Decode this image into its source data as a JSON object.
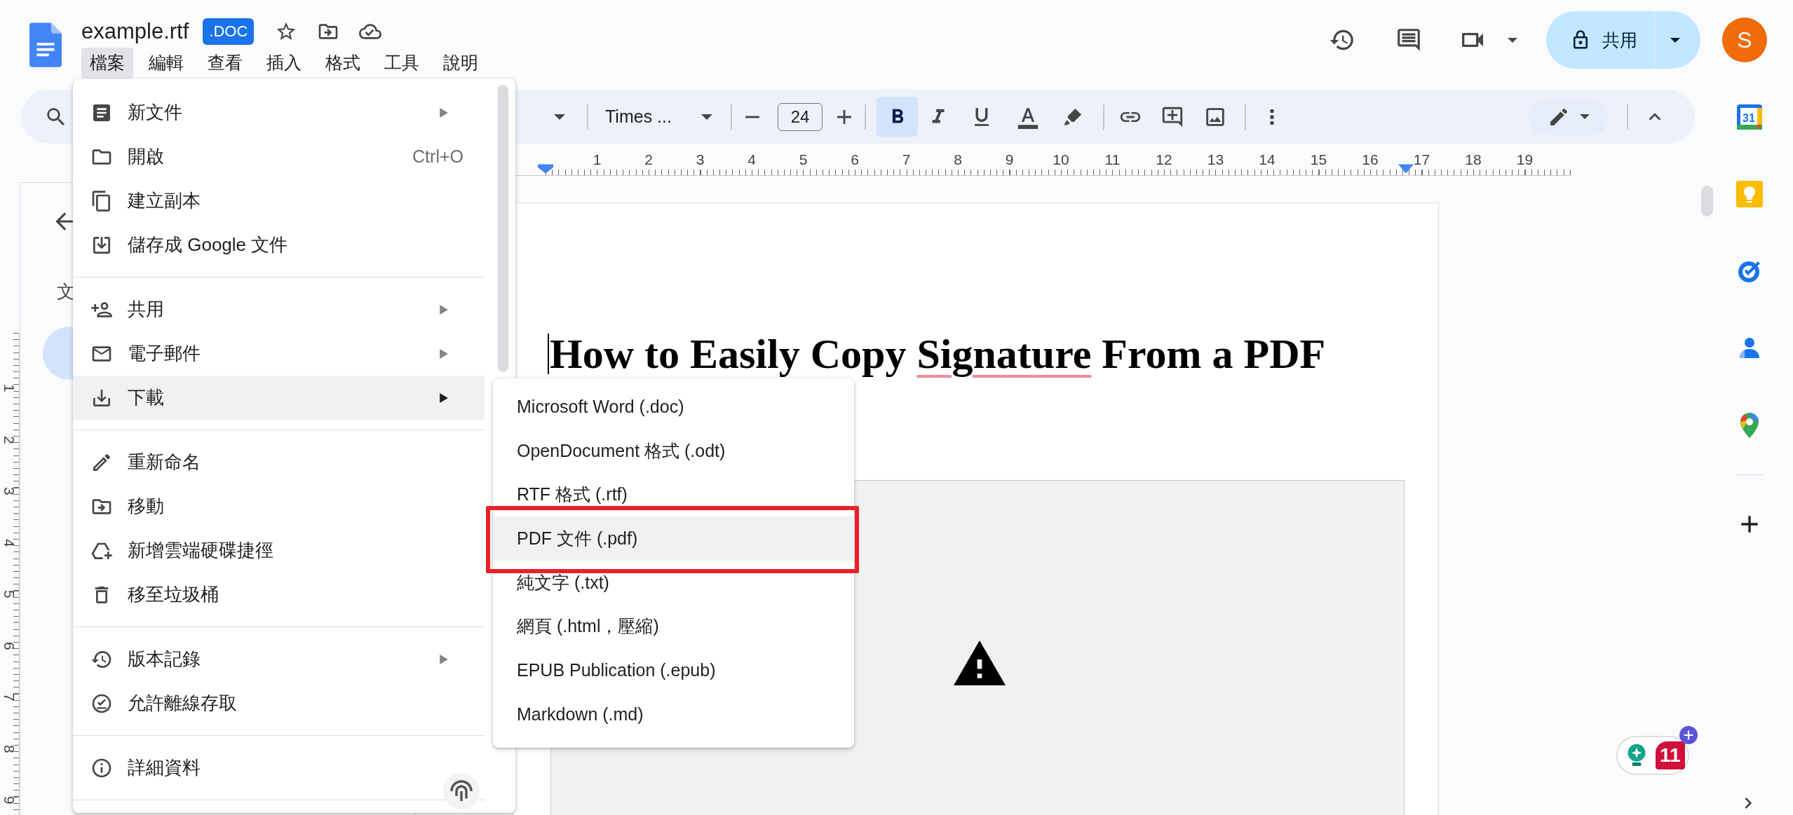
{
  "document": {
    "title": "example.rtf",
    "badge": ".DOC"
  },
  "menu_bar": [
    {
      "label": "檔案",
      "selected": true
    },
    {
      "label": "編輯",
      "selected": false
    },
    {
      "label": "查看",
      "selected": false
    },
    {
      "label": "插入",
      "selected": false
    },
    {
      "label": "格式",
      "selected": false
    },
    {
      "label": "工具",
      "selected": false
    },
    {
      "label": "說明",
      "selected": false
    }
  ],
  "share_button": {
    "label": "共用"
  },
  "avatar": {
    "initial": "S"
  },
  "toolbar": {
    "font": "Times ...",
    "font_size": "24",
    "bold": true,
    "italic": false,
    "underline": false
  },
  "ruler": {
    "marks": [
      "1",
      "2",
      "3",
      "4",
      "5",
      "6",
      "7",
      "8",
      "9",
      "10",
      "11",
      "12",
      "13",
      "14",
      "15",
      "16",
      "17",
      "18",
      "19"
    ]
  },
  "vertical_ruler": {
    "marks": [
      "1",
      "2",
      "3",
      "4",
      "5",
      "6",
      "7",
      "8",
      "9"
    ]
  },
  "outline_panel": {
    "label": "文"
  },
  "page": {
    "heading": [
      {
        "text": "How to Easily Copy ",
        "flagged": false
      },
      {
        "text": "Signature",
        "flagged": true
      },
      {
        "text": " From a PDF",
        "flagged": false
      }
    ]
  },
  "file_menu": {
    "sections": [
      {
        "items": [
          {
            "label": "新文件",
            "submenu": true,
            "selected": false
          },
          {
            "label": "開啟",
            "shortcut": "Ctrl+O",
            "submenu": false,
            "selected": false
          },
          {
            "label": "建立副本",
            "submenu": false,
            "selected": false
          },
          {
            "label": "儲存成 Google 文件",
            "submenu": false,
            "selected": false
          }
        ]
      },
      {
        "items": [
          {
            "label": "共用",
            "submenu": true,
            "selected": false
          },
          {
            "label": "電子郵件",
            "submenu": true,
            "selected": false
          },
          {
            "label": "下載",
            "submenu": true,
            "selected": true
          }
        ]
      },
      {
        "items": [
          {
            "label": "重新命名",
            "submenu": false,
            "selected": false
          },
          {
            "label": "移動",
            "submenu": false,
            "selected": false
          },
          {
            "label": "新增雲端硬碟捷徑",
            "submenu": false,
            "selected": false
          },
          {
            "label": "移至垃圾桶",
            "submenu": false,
            "selected": false
          }
        ]
      },
      {
        "items": [
          {
            "label": "版本記錄",
            "submenu": true,
            "selected": false
          },
          {
            "label": "允許離線存取",
            "submenu": false,
            "selected": false
          }
        ]
      },
      {
        "items": [
          {
            "label": "詳細資料",
            "submenu": false,
            "selected": false
          }
        ]
      }
    ]
  },
  "download_submenu": {
    "items": [
      {
        "label": "Microsoft Word (.doc)",
        "selected": false,
        "callout": false
      },
      {
        "label": "OpenDocument 格式 (.odt)",
        "selected": false,
        "callout": false
      },
      {
        "label": "RTF 格式 (.rtf)",
        "selected": false,
        "callout": false
      },
      {
        "label": "PDF 文件 (.pdf)",
        "selected": true,
        "callout": true
      },
      {
        "label": "純文字 (.txt)",
        "selected": false,
        "callout": false
      },
      {
        "label": "網頁 (.html，壓縮)",
        "selected": false,
        "callout": false
      },
      {
        "label": "EPUB Publication (.epub)",
        "selected": false,
        "callout": false
      },
      {
        "label": "Markdown (.md)",
        "selected": false,
        "callout": false
      }
    ]
  },
  "side_panel": {
    "calendar_day": "31"
  },
  "assistant_badge": {
    "count": "11"
  }
}
